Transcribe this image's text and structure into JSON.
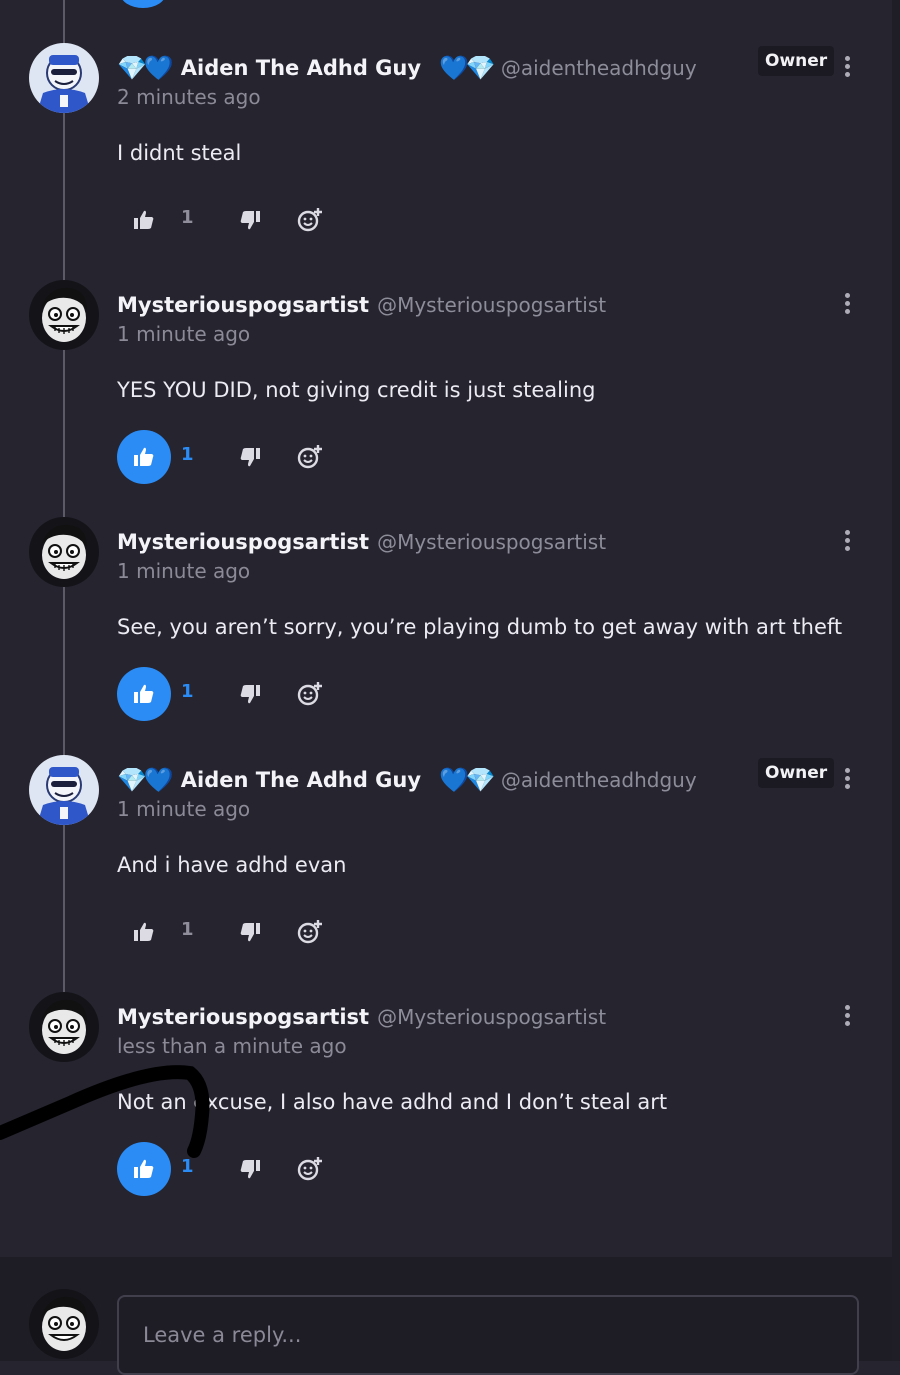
{
  "comments": [
    {
      "author": "Aiden The Adhd Guy",
      "badge_pre": "💎💙",
      "badge_post": "💙💎",
      "handle": "@aidentheadhdguy",
      "role": "Owner",
      "time": "2 minutes ago",
      "text": "I didnt steal",
      "likes": "1",
      "liked": false,
      "avatar": "blue-character-avatar"
    },
    {
      "author": "Mysteriouspogsartist",
      "badge_pre": "",
      "badge_post": "",
      "handle": "@Mysteriouspogsartist",
      "role": "",
      "time": "1 minute ago",
      "text": "YES YOU DID, not giving credit is just stealing",
      "likes": "1",
      "liked": true,
      "avatar": "grinning-face-avatar"
    },
    {
      "author": "Mysteriouspogsartist",
      "badge_pre": "",
      "badge_post": "",
      "handle": "@Mysteriouspogsartist",
      "role": "",
      "time": "1 minute ago",
      "text": "See, you aren’t sorry, you’re playing dumb to get away with art theft",
      "likes": "1",
      "liked": true,
      "avatar": "grinning-face-avatar"
    },
    {
      "author": "Aiden The Adhd Guy",
      "badge_pre": "💎💙",
      "badge_post": "💙💎",
      "handle": "@aidentheadhdguy",
      "role": "Owner",
      "time": "1 minute ago",
      "text": "And i have adhd evan",
      "likes": "1",
      "liked": false,
      "avatar": "blue-character-avatar"
    },
    {
      "author": "Mysteriouspogsartist",
      "badge_pre": "",
      "badge_post": "",
      "handle": "@Mysteriouspogsartist",
      "role": "",
      "time": "less than a minute ago",
      "text": "Not an excuse, I also have adhd and I don’t steal art",
      "likes": "1",
      "liked": true,
      "avatar": "grinning-face-avatar"
    }
  ],
  "reply": {
    "placeholder": "Leave a reply..."
  },
  "colors": {
    "background": "#25242f",
    "accent": "#2b8cf5",
    "muted": "#8b8a96"
  },
  "icons": [
    "thumbs-up-icon",
    "thumbs-down-icon",
    "add-reaction-icon",
    "more-vertical-icon"
  ]
}
